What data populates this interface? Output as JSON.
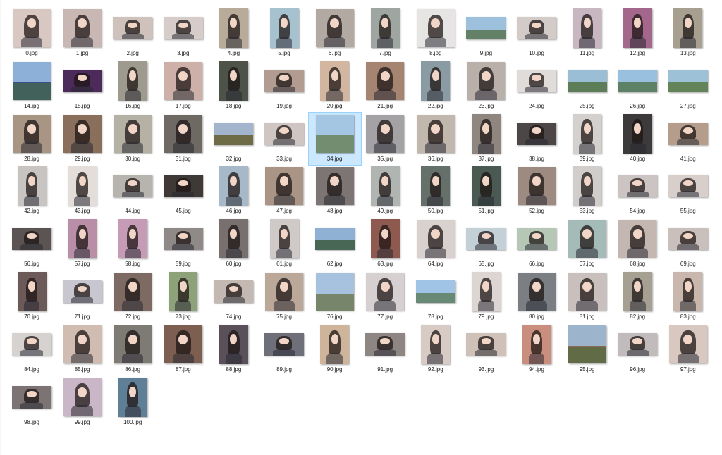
{
  "files": [
    {
      "name": "0.jpg",
      "shape": "square",
      "color": "#d9c8c2",
      "kind": "person"
    },
    {
      "name": "1.jpg",
      "shape": "square",
      "color": "#c9b7b4",
      "kind": "person"
    },
    {
      "name": "2.jpg",
      "shape": "land",
      "color": "#cfc2bd",
      "kind": "person"
    },
    {
      "name": "3.jpg",
      "shape": "land",
      "color": "#d6cdca",
      "kind": "person"
    },
    {
      "name": "4.jpg",
      "shape": "port",
      "color": "#b9ab9a",
      "kind": "person"
    },
    {
      "name": "5.jpg",
      "shape": "port",
      "color": "#a7c2cf",
      "kind": "person"
    },
    {
      "name": "6.jpg",
      "shape": "square",
      "color": "#b2a9a3",
      "kind": "person"
    },
    {
      "name": "7.jpg",
      "shape": "port",
      "color": "#9fa6a2",
      "kind": "person"
    },
    {
      "name": "8.jpg",
      "shape": "square",
      "color": "#e7e4e4",
      "kind": "person"
    },
    {
      "name": "9.jpg",
      "shape": "land",
      "color": "#8f9ea6",
      "kind": "scene"
    },
    {
      "name": "10.jpg",
      "shape": "land",
      "color": "#d2cbc8",
      "kind": "person"
    },
    {
      "name": "11.jpg",
      "shape": "port",
      "color": "#c8b7c1",
      "kind": "person"
    },
    {
      "name": "12.jpg",
      "shape": "port",
      "color": "#a4678c",
      "kind": "person"
    },
    {
      "name": "13.jpg",
      "shape": "port",
      "color": "#a79f8f",
      "kind": "person"
    },
    {
      "name": "14.jpg",
      "shape": "square",
      "color": "#3d4f8a",
      "kind": "scene"
    },
    {
      "name": "15.jpg",
      "shape": "land",
      "color": "#4c2b5a",
      "kind": "person"
    },
    {
      "name": "16.jpg",
      "shape": "port",
      "color": "#9e9a8d",
      "kind": "person"
    },
    {
      "name": "17.jpg",
      "shape": "square",
      "color": "#cdb1a8",
      "kind": "person"
    },
    {
      "name": "18.jpg",
      "shape": "port",
      "color": "#4d5348",
      "kind": "person"
    },
    {
      "name": "19.jpg",
      "shape": "land",
      "color": "#b29b90",
      "kind": "person"
    },
    {
      "name": "20.jpg",
      "shape": "port",
      "color": "#d2b69f",
      "kind": "person"
    },
    {
      "name": "21.jpg",
      "shape": "square",
      "color": "#a58472",
      "kind": "person"
    },
    {
      "name": "22.jpg",
      "shape": "port",
      "color": "#8a9ba3",
      "kind": "person"
    },
    {
      "name": "23.jpg",
      "shape": "square",
      "color": "#b9b0aa",
      "kind": "person"
    },
    {
      "name": "24.jpg",
      "shape": "land",
      "color": "#e0dcd9",
      "kind": "person"
    },
    {
      "name": "25.jpg",
      "shape": "land",
      "color": "#7e9581",
      "kind": "scene"
    },
    {
      "name": "26.jpg",
      "shape": "land",
      "color": "#7f9fa8",
      "kind": "scene"
    },
    {
      "name": "27.jpg",
      "shape": "land",
      "color": "#8fa584",
      "kind": "scene"
    },
    {
      "name": "28.jpg",
      "shape": "square",
      "color": "#a89583",
      "kind": "person"
    },
    {
      "name": "29.jpg",
      "shape": "square",
      "color": "#8a6f5c",
      "kind": "person"
    },
    {
      "name": "30.jpg",
      "shape": "square",
      "color": "#b6b1a5",
      "kind": "person"
    },
    {
      "name": "31.jpg",
      "shape": "square",
      "color": "#6f6963",
      "kind": "person"
    },
    {
      "name": "32.jpg",
      "shape": "land",
      "color": "#a86a55",
      "kind": "scene"
    },
    {
      "name": "33.jpg",
      "shape": "land",
      "color": "#cfc6c3",
      "kind": "person"
    },
    {
      "name": "34.jpg",
      "shape": "square",
      "color": "#b7bcbf",
      "kind": "scene",
      "selected": true
    },
    {
      "name": "35.jpg",
      "shape": "square",
      "color": "#a5a2a6",
      "kind": "person"
    },
    {
      "name": "36.jpg",
      "shape": "square",
      "color": "#c2b7ad",
      "kind": "person"
    },
    {
      "name": "37.jpg",
      "shape": "port",
      "color": "#8f8680",
      "kind": "person"
    },
    {
      "name": "38.jpg",
      "shape": "land",
      "color": "#4c4746",
      "kind": "person"
    },
    {
      "name": "39.jpg",
      "shape": "port",
      "color": "#d4d0cd",
      "kind": "person"
    },
    {
      "name": "40.jpg",
      "shape": "port",
      "color": "#3c3a3b",
      "kind": "person"
    },
    {
      "name": "41.jpg",
      "shape": "land",
      "color": "#b49d8b",
      "kind": "person"
    },
    {
      "name": "42.jpg",
      "shape": "port",
      "color": "#c7c4c1",
      "kind": "person"
    },
    {
      "name": "43.jpg",
      "shape": "port",
      "color": "#e4dedb",
      "kind": "person"
    },
    {
      "name": "44.jpg",
      "shape": "land",
      "color": "#b7b3ad",
      "kind": "person"
    },
    {
      "name": "45.jpg",
      "shape": "land",
      "color": "#3e3836",
      "kind": "person"
    },
    {
      "name": "46.jpg",
      "shape": "port",
      "color": "#a7b9c8",
      "kind": "person"
    },
    {
      "name": "47.jpg",
      "shape": "square",
      "color": "#a99486",
      "kind": "person"
    },
    {
      "name": "48.jpg",
      "shape": "square",
      "color": "#7d7573",
      "kind": "person"
    },
    {
      "name": "49.jpg",
      "shape": "port",
      "color": "#b0b5b2",
      "kind": "person"
    },
    {
      "name": "50.jpg",
      "shape": "port",
      "color": "#66706a",
      "kind": "person"
    },
    {
      "name": "51.jpg",
      "shape": "port",
      "color": "#4a5a52",
      "kind": "person"
    },
    {
      "name": "52.jpg",
      "shape": "square",
      "color": "#9d8a80",
      "kind": "person"
    },
    {
      "name": "53.jpg",
      "shape": "port",
      "color": "#d0cdcb",
      "kind": "person"
    },
    {
      "name": "54.jpg",
      "shape": "land",
      "color": "#cbc4c2",
      "kind": "person"
    },
    {
      "name": "55.jpg",
      "shape": "land",
      "color": "#d8cfcb",
      "kind": "person"
    },
    {
      "name": "56.jpg",
      "shape": "land",
      "color": "#5c5452",
      "kind": "person"
    },
    {
      "name": "57.jpg",
      "shape": "port",
      "color": "#b88fa6",
      "kind": "person"
    },
    {
      "name": "58.jpg",
      "shape": "port",
      "color": "#c59bb6",
      "kind": "person"
    },
    {
      "name": "59.jpg",
      "shape": "land",
      "color": "#8f8987",
      "kind": "person"
    },
    {
      "name": "60.jpg",
      "shape": "port",
      "color": "#77706e",
      "kind": "person"
    },
    {
      "name": "61.jpg",
      "shape": "port",
      "color": "#cfcac8",
      "kind": "person"
    },
    {
      "name": "62.jpg",
      "shape": "land",
      "color": "#4b5d78",
      "kind": "scene"
    },
    {
      "name": "63.jpg",
      "shape": "port",
      "color": "#8e5a4f",
      "kind": "person"
    },
    {
      "name": "64.jpg",
      "shape": "square",
      "color": "#d9d1cd",
      "kind": "person"
    },
    {
      "name": "65.jpg",
      "shape": "land",
      "color": "#c3d0d6",
      "kind": "person"
    },
    {
      "name": "66.jpg",
      "shape": "land",
      "color": "#b7c7b5",
      "kind": "person"
    },
    {
      "name": "67.jpg",
      "shape": "square",
      "color": "#a4bbb8",
      "kind": "person"
    },
    {
      "name": "68.jpg",
      "shape": "square",
      "color": "#c4b6b1",
      "kind": "person"
    },
    {
      "name": "69.jpg",
      "shape": "land",
      "color": "#c9bfbb",
      "kind": "person"
    },
    {
      "name": "70.jpg",
      "shape": "port",
      "color": "#6c5a58",
      "kind": "person"
    },
    {
      "name": "71.jpg",
      "shape": "land",
      "color": "#c8c6ce",
      "kind": "person"
    },
    {
      "name": "72.jpg",
      "shape": "square",
      "color": "#7d6b63",
      "kind": "person"
    },
    {
      "name": "73.jpg",
      "shape": "port",
      "color": "#8ea27a",
      "kind": "person"
    },
    {
      "name": "74.jpg",
      "shape": "land",
      "color": "#c4b8b2",
      "kind": "person"
    },
    {
      "name": "75.jpg",
      "shape": "square",
      "color": "#bca899",
      "kind": "person"
    },
    {
      "name": "76.jpg",
      "shape": "square",
      "color": "#c0a8b0",
      "kind": "scene"
    },
    {
      "name": "77.jpg",
      "shape": "square",
      "color": "#d6d0d0",
      "kind": "person"
    },
    {
      "name": "78.jpg",
      "shape": "land",
      "color": "#9fb2cf",
      "kind": "scene"
    },
    {
      "name": "79.jpg",
      "shape": "port",
      "color": "#ddd5d1",
      "kind": "person"
    },
    {
      "name": "80.jpg",
      "shape": "square",
      "color": "#7b7f84",
      "kind": "person"
    },
    {
      "name": "81.jpg",
      "shape": "square",
      "color": "#c9c0bd",
      "kind": "person"
    },
    {
      "name": "82.jpg",
      "shape": "port",
      "color": "#a6a092",
      "kind": "person"
    },
    {
      "name": "83.jpg",
      "shape": "port",
      "color": "#c9b6ac",
      "kind": "person"
    },
    {
      "name": "84.jpg",
      "shape": "land",
      "color": "#d6d2d0",
      "kind": "person"
    },
    {
      "name": "85.jpg",
      "shape": "square",
      "color": "#d1bcb2",
      "kind": "person"
    },
    {
      "name": "86.jpg",
      "shape": "square",
      "color": "#7e7b74",
      "kind": "person"
    },
    {
      "name": "87.jpg",
      "shape": "square",
      "color": "#7d5f52",
      "kind": "person"
    },
    {
      "name": "88.jpg",
      "shape": "port",
      "color": "#5a5059",
      "kind": "person"
    },
    {
      "name": "89.jpg",
      "shape": "land",
      "color": "#6e6f79",
      "kind": "person"
    },
    {
      "name": "90.jpg",
      "shape": "port",
      "color": "#cdb49a",
      "kind": "person"
    },
    {
      "name": "91.jpg",
      "shape": "land",
      "color": "#8e8682",
      "kind": "person"
    },
    {
      "name": "92.jpg",
      "shape": "port",
      "color": "#d8cbc6",
      "kind": "person"
    },
    {
      "name": "93.jpg",
      "shape": "land",
      "color": "#cfc0b8",
      "kind": "person"
    },
    {
      "name": "94.jpg",
      "shape": "port",
      "color": "#c98e7d",
      "kind": "person"
    },
    {
      "name": "95.jpg",
      "shape": "square",
      "color": "#8a6a56",
      "kind": "scene"
    },
    {
      "name": "96.jpg",
      "shape": "land",
      "color": "#c2bbbb",
      "kind": "person"
    },
    {
      "name": "97.jpg",
      "shape": "square",
      "color": "#d8c8c0",
      "kind": "person"
    },
    {
      "name": "98.jpg",
      "shape": "land",
      "color": "#7c7474",
      "kind": "person"
    },
    {
      "name": "99.jpg",
      "shape": "square",
      "color": "#c9b6c6",
      "kind": "person"
    },
    {
      "name": "100.jpg",
      "shape": "port",
      "color": "#5f7f97",
      "kind": "person"
    }
  ]
}
